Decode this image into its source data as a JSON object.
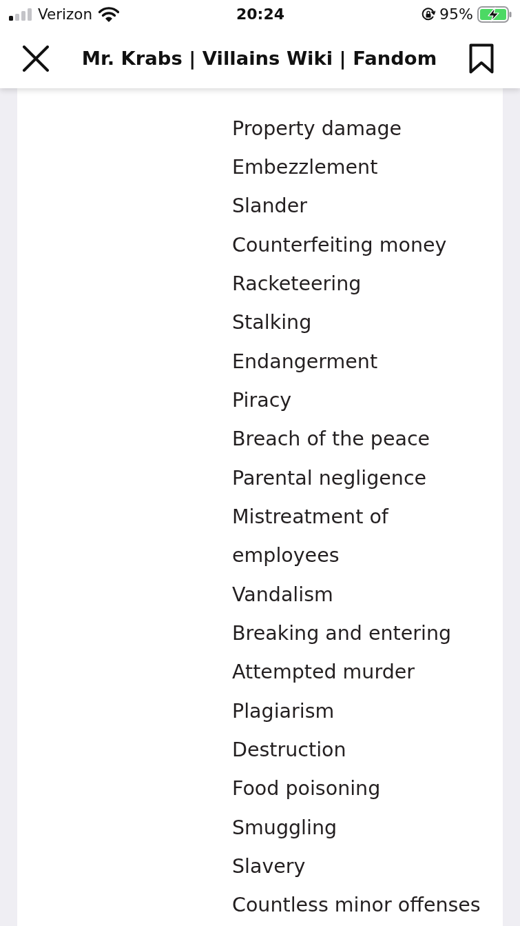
{
  "status_bar": {
    "carrier": "Verizon",
    "time": "20:24",
    "battery": "95%"
  },
  "header": {
    "title": "Mr. Krabs | Villains Wiki | Fandom"
  },
  "list": {
    "items": [
      "Property damage",
      "Embezzlement",
      "Slander",
      "Counterfeiting money",
      "Racketeering",
      "Stalking",
      "Endangerment",
      "Piracy",
      "Breach of the peace",
      "Parental negligence",
      "Mistreatment of employees",
      "Vandalism",
      "Breaking and entering",
      "Attempted murder",
      "Plagiarism",
      "Destruction",
      "Food poisoning",
      "Smuggling",
      "Slavery",
      "Countless minor offenses"
    ]
  }
}
